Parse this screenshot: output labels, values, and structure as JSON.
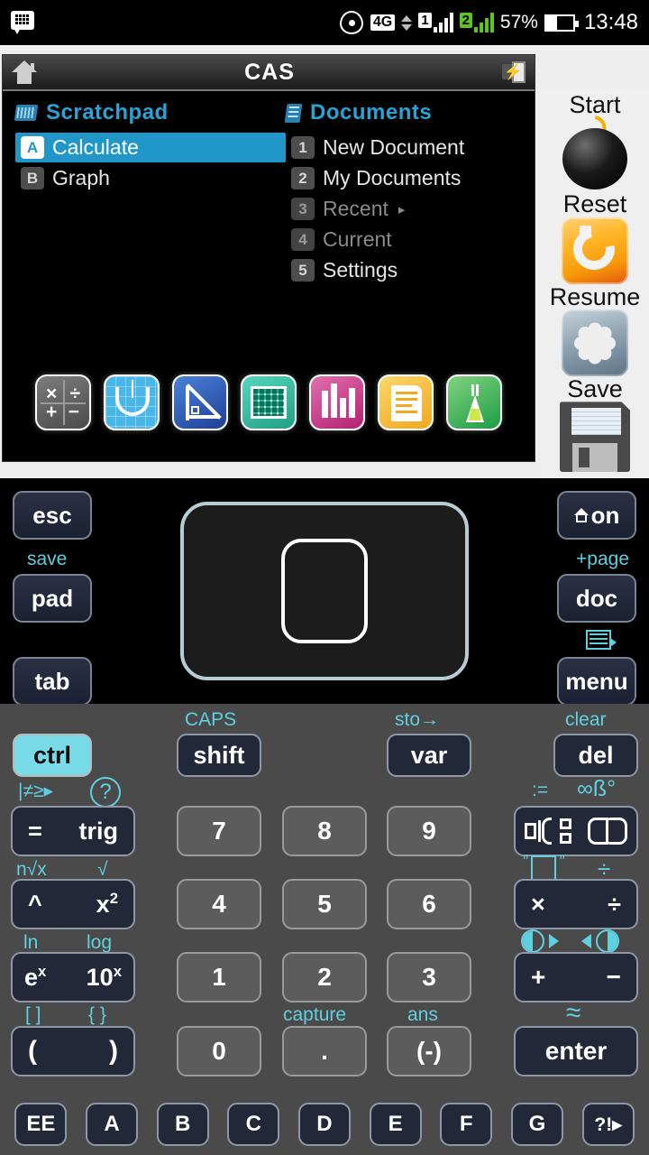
{
  "status_bar": {
    "message_icon": "blackberry-messenger-icon",
    "hotspot_icon": "hotspot-icon",
    "network_type": "4G",
    "sim1_label": "1",
    "sim2_label": "2",
    "battery_percent": "57%",
    "clock": "13:48"
  },
  "emulator": {
    "title": "CAS",
    "home_icon": "home-icon",
    "battery_icon": "battery-charging-icon",
    "scratchpad": {
      "heading": "Scratchpad",
      "icon": "scratchpad-icon",
      "items": [
        {
          "key": "A",
          "label": "Calculate",
          "selected": true
        },
        {
          "key": "B",
          "label": "Graph",
          "selected": false
        }
      ]
    },
    "documents": {
      "heading": "Documents",
      "icon": "documents-icon",
      "items": [
        {
          "key": "1",
          "label": "New Document",
          "dimmed": false,
          "arrow": ""
        },
        {
          "key": "2",
          "label": "My Documents",
          "dimmed": false,
          "arrow": ""
        },
        {
          "key": "3",
          "label": "Recent",
          "dimmed": true,
          "arrow": "▸"
        },
        {
          "key": "4",
          "label": "Current",
          "dimmed": true,
          "arrow": ""
        },
        {
          "key": "5",
          "label": "Settings",
          "dimmed": false,
          "arrow": ""
        }
      ]
    },
    "apps": [
      {
        "name": "calculator-app-icon",
        "color": "#6a6a6a"
      },
      {
        "name": "graph-app-icon",
        "color": "#49b6e8"
      },
      {
        "name": "geometry-app-icon",
        "color": "#2b52ad"
      },
      {
        "name": "lists-spreadsheet-app-icon",
        "color": "#2cab92"
      },
      {
        "name": "data-statistics-app-icon",
        "color": "#c73b86"
      },
      {
        "name": "notes-app-icon",
        "color": "#f0a81c"
      },
      {
        "name": "vernier-lab-app-icon",
        "color": "#3fa85c"
      }
    ]
  },
  "rail": {
    "start_label": "Start",
    "start_icon": "bomb-icon",
    "reset_label": "Reset",
    "reset_icon": "refresh-icon",
    "resume_label": "Resume",
    "resume_icon": "asterisk-icon",
    "save_label": "Save",
    "save_icon": "floppy-disk-icon"
  },
  "touchpad": {
    "esc": "esc",
    "pad": "pad",
    "tab": "tab",
    "on": "on",
    "doc": "doc",
    "menu": "menu",
    "save_secondary": "save",
    "page_secondary": "+page",
    "home_icon": "home-icon",
    "pagelist_icon": "page-list-icon"
  },
  "keypad": {
    "ctrl": "ctrl",
    "shift": "shift",
    "shift_secondary": "CAPS",
    "var": "var",
    "var_secondary": "sto→",
    "del": "del",
    "del_secondary": "clear",
    "eq": "=",
    "trig": "trig",
    "eq_secondary": "|≠≥▸",
    "help_icon": "question-mark-icon",
    "pow": "^",
    "xsq": "x",
    "xsq_sup": "2",
    "pow_secondary_left": "n√x",
    "pow_secondary_right": "√",
    "ex": "e",
    "ex_sup": "x",
    "tenx": "10",
    "tenx_sup": "x",
    "ex_secondary_left": "ln",
    "ex_secondary_right": "log",
    "lparen": "(",
    "rparen": ")",
    "paren_secondary_left": "[ ]",
    "paren_secondary_right": "{ }",
    "digits": [
      "7",
      "8",
      "9",
      "4",
      "5",
      "6",
      "1",
      "2",
      "3"
    ],
    "zero": "0",
    "dot": ".",
    "neg": "(-)",
    "dot_secondary": "capture",
    "neg_secondary": "ans",
    "template_icon": "math-template-icon",
    "catalog_icon": "catalog-book-icon",
    "template_secondary_left": ":=",
    "template_secondary_right": "∞ß°",
    "mult": "×",
    "div": "÷",
    "mult_secondary_right": "÷",
    "plus": "+",
    "minus": "−",
    "contrast_icon_left": "contrast-increase-icon",
    "contrast_icon_right": "contrast-decrease-icon",
    "enter": "enter",
    "enter_secondary": "≈",
    "alpha_row": [
      "EE",
      "A",
      "B",
      "C",
      "D",
      "E",
      "F",
      "G",
      "?!▸"
    ]
  }
}
